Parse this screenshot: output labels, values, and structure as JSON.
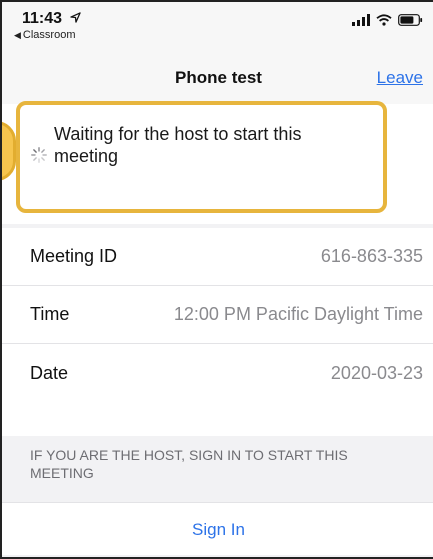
{
  "status_bar": {
    "time": "11:43",
    "back_app": "Classroom"
  },
  "nav": {
    "title": "Phone test",
    "leave_label": "Leave"
  },
  "waiting": {
    "message": "Waiting for the host to start this meeting"
  },
  "details": [
    {
      "label": "Meeting ID",
      "value": "616-863-335"
    },
    {
      "label": "Time",
      "value": "12:00 PM Pacific Daylight Time"
    },
    {
      "label": "Date",
      "value": "2020-03-23"
    }
  ],
  "host_notice": {
    "text": "IF YOU ARE THE HOST, SIGN IN TO START THIS MEETING",
    "signin_label": "Sign In"
  },
  "colors": {
    "accent": "#2d73e8",
    "highlight": "#e7b53d"
  },
  "icons": [
    "location-arrow-icon",
    "back-arrow-icon",
    "signal-icon",
    "wifi-icon",
    "battery-icon",
    "loading-spinner-icon"
  ]
}
